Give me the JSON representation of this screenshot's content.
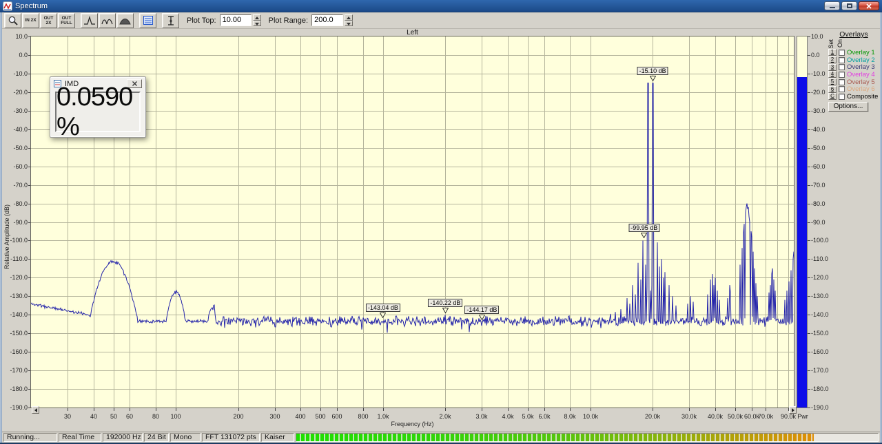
{
  "window": {
    "title": "Spectrum"
  },
  "toolbar": {
    "zoom_in_label": "IN 2X",
    "zoom_out_label": "OUT 2X",
    "zoom_full_label": "OUT FULL",
    "plot_top_label": "Plot Top:",
    "plot_top_value": "10.00",
    "plot_range_label": "Plot Range:",
    "plot_range_value": "200.0"
  },
  "imd_window": {
    "title": "IMD",
    "value": "0.0590 %"
  },
  "overlays": {
    "title": "Overlays",
    "set_label": "Set",
    "on_label": "On",
    "options_label": "Options...",
    "items": [
      {
        "key": "1",
        "label": "Overlay 1",
        "color": "#009600"
      },
      {
        "key": "2",
        "label": "Overlay 2",
        "color": "#00a0a0"
      },
      {
        "key": "3",
        "label": "Overlay 3",
        "color": "#3c3c78"
      },
      {
        "key": "4",
        "label": "Overlay 4",
        "color": "#e23ce2"
      },
      {
        "key": "5",
        "label": "Overlay 5",
        "color": "#a85a50"
      },
      {
        "key": "6",
        "label": "Overlay 6",
        "color": "#dcaa82"
      },
      {
        "key": "C",
        "label": "Composite",
        "color": "#000000"
      }
    ]
  },
  "status_bar": {
    "cells": [
      "Running...",
      "Real Time",
      "192000 Hz",
      "24 Bit",
      "Mono",
      "FFT 131072 pts",
      "Kaiser"
    ],
    "progress_percent": 89
  },
  "chart_data": {
    "type": "line",
    "title": "Left",
    "xlabel": "Frequency (Hz)",
    "ylabel": "Relative Amplitude (dB)",
    "x_scale": "log",
    "xlim": [
      20,
      96000
    ],
    "ylim": [
      -190,
      10
    ],
    "grid": true,
    "plot_bg": "#ffffdc",
    "grid_color": "#b4b49b",
    "trace_color": "#2525aa",
    "seed": 11,
    "noise_floor_db": -143.5,
    "noise_jitter_db": 3.1,
    "lf_shelf_db": 9.5,
    "y_ticks": [
      "10.0",
      "0.0",
      "-10.0",
      "-20.0",
      "-30.0",
      "-40.0",
      "-50.0",
      "-60.0",
      "-70.0",
      "-80.0",
      "-90.0",
      "-100.0",
      "-110.0",
      "-120.0",
      "-130.0",
      "-140.0",
      "-150.0",
      "-160.0",
      "-170.0",
      "-180.0",
      "-190.0"
    ],
    "x_grid": [
      30,
      40,
      50,
      60,
      80,
      100,
      200,
      300,
      400,
      500,
      600,
      800,
      1000,
      2000,
      3000,
      4000,
      5000,
      6000,
      8000,
      10000,
      20000,
      30000,
      40000,
      50000,
      60000,
      70000,
      80000,
      90000
    ],
    "x_ticks": [
      {
        "f": 30,
        "label": "30"
      },
      {
        "f": 40,
        "label": "40"
      },
      {
        "f": 50,
        "label": "50"
      },
      {
        "f": 60,
        "label": "60"
      },
      {
        "f": 80,
        "label": "80"
      },
      {
        "f": 100,
        "label": "100"
      },
      {
        "f": 200,
        "label": "200"
      },
      {
        "f": 300,
        "label": "300"
      },
      {
        "f": 400,
        "label": "400"
      },
      {
        "f": 500,
        "label": "500"
      },
      {
        "f": 600,
        "label": "600"
      },
      {
        "f": 800,
        "label": "800"
      },
      {
        "f": 1000,
        "label": "1.0k"
      },
      {
        "f": 2000,
        "label": "2.0k"
      },
      {
        "f": 3000,
        "label": "3.0k"
      },
      {
        "f": 4000,
        "label": "4.0k"
      },
      {
        "f": 5000,
        "label": "5.0k"
      },
      {
        "f": 6000,
        "label": "6.0k"
      },
      {
        "f": 8000,
        "label": "8.0k"
      },
      {
        "f": 10000,
        "label": "10.0k"
      },
      {
        "f": 20000,
        "label": "20.0k"
      },
      {
        "f": 30000,
        "label": "30.0k"
      },
      {
        "f": 40000,
        "label": "40.0k"
      },
      {
        "f": 50000,
        "label": "50.0k"
      },
      {
        "f": 60000,
        "label": "60.0k"
      },
      {
        "f": 70000,
        "label": "70.0k"
      },
      {
        "f": 90000,
        "label": "90.0k"
      }
    ],
    "bumps": [
      [
        50,
        -111,
        0.16
      ],
      [
        100,
        -127.5,
        0.09
      ],
      [
        150,
        -135.5,
        0.06
      ]
    ],
    "spikes": [
      [
        2000,
        -140.2
      ],
      [
        12500,
        -139.5
      ],
      [
        13200,
        -138.5
      ],
      [
        14000,
        -137
      ],
      [
        15000,
        -131
      ],
      [
        15500,
        -134
      ],
      [
        16000,
        -124
      ],
      [
        16500,
        -129
      ],
      [
        17000,
        -112
      ],
      [
        17500,
        -121
      ],
      [
        18000,
        -100
      ],
      [
        18500,
        -113
      ],
      [
        18800,
        -125
      ],
      [
        19000,
        -15.1,
        2
      ],
      [
        19500,
        -127
      ],
      [
        19800,
        -124
      ],
      [
        20000,
        -15.2,
        2
      ],
      [
        20200,
        -126
      ],
      [
        21000,
        -101
      ],
      [
        21500,
        -114
      ],
      [
        22000,
        -110
      ],
      [
        22500,
        -120
      ],
      [
        23000,
        -117
      ],
      [
        24000,
        -124
      ],
      [
        25000,
        -130
      ],
      [
        26000,
        -135
      ],
      [
        29500,
        -134
      ],
      [
        30500,
        -130
      ],
      [
        31500,
        -133
      ],
      [
        37000,
        -129
      ],
      [
        38000,
        -121
      ],
      [
        39000,
        -118
      ],
      [
        39500,
        -124
      ],
      [
        40000,
        -120
      ],
      [
        41000,
        -127
      ],
      [
        42000,
        -132
      ],
      [
        46000,
        -131
      ],
      [
        47000,
        -124
      ],
      [
        47500,
        -128
      ],
      [
        53000,
        -113
      ],
      [
        54000,
        -104
      ],
      [
        55000,
        -96
      ],
      [
        55500,
        -91
      ],
      [
        56000,
        -85
      ],
      [
        56500,
        -82
      ],
      [
        57000,
        -80
      ],
      [
        57500,
        -83
      ],
      [
        58000,
        -82
      ],
      [
        58500,
        -87
      ],
      [
        59000,
        -90
      ],
      [
        59500,
        -95
      ],
      [
        60000,
        -98
      ],
      [
        61000,
        -106
      ],
      [
        62000,
        -115
      ],
      [
        63000,
        -123
      ],
      [
        64000,
        -130
      ],
      [
        73000,
        -128
      ],
      [
        74000,
        -124
      ],
      [
        75000,
        -118
      ],
      [
        75500,
        -115
      ],
      [
        76000,
        -116
      ],
      [
        77000,
        -121
      ],
      [
        78000,
        -127
      ],
      [
        87000,
        -132
      ],
      [
        89000,
        -127
      ],
      [
        91000,
        -122
      ],
      [
        93000,
        -116
      ],
      [
        95000,
        -110
      ],
      [
        95800,
        -106
      ]
    ],
    "markers": [
      {
        "f": 20000,
        "db": -15.1,
        "label": "-15.10 dB"
      },
      {
        "f": 18200,
        "db": -99.95,
        "label": "-99.95 dB"
      },
      {
        "f": 1000,
        "db": -143.04,
        "label": "-143.04 dB"
      },
      {
        "f": 2000,
        "db": -140.22,
        "label": "-140.22 dB"
      },
      {
        "f": 3000,
        "db": -144.17,
        "label": "-144.17 dB"
      }
    ],
    "power_bar": {
      "label": "Pwr",
      "level_db": -11.9,
      "fill_color": "#0d0de8",
      "bg_color": "#ffffdc"
    }
  }
}
